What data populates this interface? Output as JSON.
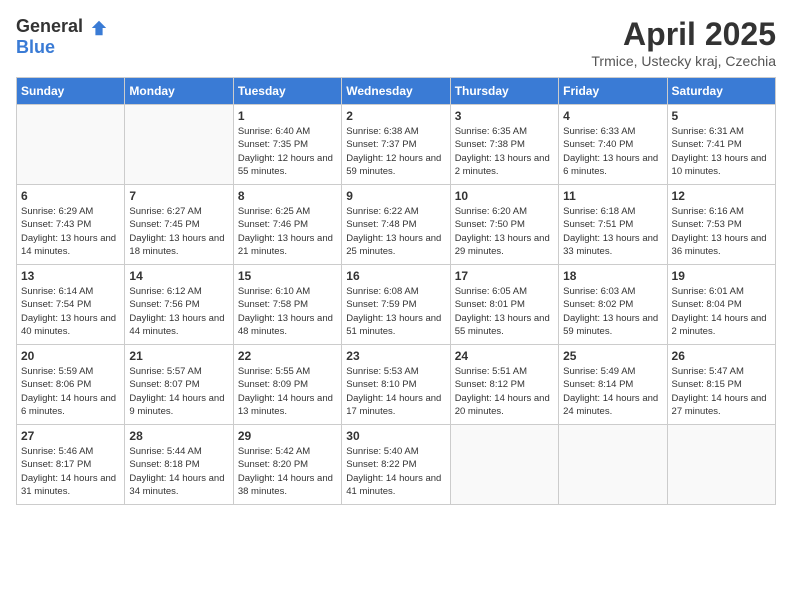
{
  "header": {
    "logo_general": "General",
    "logo_blue": "Blue",
    "title": "April 2025",
    "location": "Trmice, Ustecky kraj, Czechia"
  },
  "days_of_week": [
    "Sunday",
    "Monday",
    "Tuesday",
    "Wednesday",
    "Thursday",
    "Friday",
    "Saturday"
  ],
  "weeks": [
    [
      {
        "day": "",
        "sunrise": "",
        "sunset": "",
        "daylight": "",
        "empty": true
      },
      {
        "day": "",
        "sunrise": "",
        "sunset": "",
        "daylight": "",
        "empty": true
      },
      {
        "day": "1",
        "sunrise": "Sunrise: 6:40 AM",
        "sunset": "Sunset: 7:35 PM",
        "daylight": "Daylight: 12 hours and 55 minutes."
      },
      {
        "day": "2",
        "sunrise": "Sunrise: 6:38 AM",
        "sunset": "Sunset: 7:37 PM",
        "daylight": "Daylight: 12 hours and 59 minutes."
      },
      {
        "day": "3",
        "sunrise": "Sunrise: 6:35 AM",
        "sunset": "Sunset: 7:38 PM",
        "daylight": "Daylight: 13 hours and 2 minutes."
      },
      {
        "day": "4",
        "sunrise": "Sunrise: 6:33 AM",
        "sunset": "Sunset: 7:40 PM",
        "daylight": "Daylight: 13 hours and 6 minutes."
      },
      {
        "day": "5",
        "sunrise": "Sunrise: 6:31 AM",
        "sunset": "Sunset: 7:41 PM",
        "daylight": "Daylight: 13 hours and 10 minutes."
      }
    ],
    [
      {
        "day": "6",
        "sunrise": "Sunrise: 6:29 AM",
        "sunset": "Sunset: 7:43 PM",
        "daylight": "Daylight: 13 hours and 14 minutes."
      },
      {
        "day": "7",
        "sunrise": "Sunrise: 6:27 AM",
        "sunset": "Sunset: 7:45 PM",
        "daylight": "Daylight: 13 hours and 18 minutes."
      },
      {
        "day": "8",
        "sunrise": "Sunrise: 6:25 AM",
        "sunset": "Sunset: 7:46 PM",
        "daylight": "Daylight: 13 hours and 21 minutes."
      },
      {
        "day": "9",
        "sunrise": "Sunrise: 6:22 AM",
        "sunset": "Sunset: 7:48 PM",
        "daylight": "Daylight: 13 hours and 25 minutes."
      },
      {
        "day": "10",
        "sunrise": "Sunrise: 6:20 AM",
        "sunset": "Sunset: 7:50 PM",
        "daylight": "Daylight: 13 hours and 29 minutes."
      },
      {
        "day": "11",
        "sunrise": "Sunrise: 6:18 AM",
        "sunset": "Sunset: 7:51 PM",
        "daylight": "Daylight: 13 hours and 33 minutes."
      },
      {
        "day": "12",
        "sunrise": "Sunrise: 6:16 AM",
        "sunset": "Sunset: 7:53 PM",
        "daylight": "Daylight: 13 hours and 36 minutes."
      }
    ],
    [
      {
        "day": "13",
        "sunrise": "Sunrise: 6:14 AM",
        "sunset": "Sunset: 7:54 PM",
        "daylight": "Daylight: 13 hours and 40 minutes."
      },
      {
        "day": "14",
        "sunrise": "Sunrise: 6:12 AM",
        "sunset": "Sunset: 7:56 PM",
        "daylight": "Daylight: 13 hours and 44 minutes."
      },
      {
        "day": "15",
        "sunrise": "Sunrise: 6:10 AM",
        "sunset": "Sunset: 7:58 PM",
        "daylight": "Daylight: 13 hours and 48 minutes."
      },
      {
        "day": "16",
        "sunrise": "Sunrise: 6:08 AM",
        "sunset": "Sunset: 7:59 PM",
        "daylight": "Daylight: 13 hours and 51 minutes."
      },
      {
        "day": "17",
        "sunrise": "Sunrise: 6:05 AM",
        "sunset": "Sunset: 8:01 PM",
        "daylight": "Daylight: 13 hours and 55 minutes."
      },
      {
        "day": "18",
        "sunrise": "Sunrise: 6:03 AM",
        "sunset": "Sunset: 8:02 PM",
        "daylight": "Daylight: 13 hours and 59 minutes."
      },
      {
        "day": "19",
        "sunrise": "Sunrise: 6:01 AM",
        "sunset": "Sunset: 8:04 PM",
        "daylight": "Daylight: 14 hours and 2 minutes."
      }
    ],
    [
      {
        "day": "20",
        "sunrise": "Sunrise: 5:59 AM",
        "sunset": "Sunset: 8:06 PM",
        "daylight": "Daylight: 14 hours and 6 minutes."
      },
      {
        "day": "21",
        "sunrise": "Sunrise: 5:57 AM",
        "sunset": "Sunset: 8:07 PM",
        "daylight": "Daylight: 14 hours and 9 minutes."
      },
      {
        "day": "22",
        "sunrise": "Sunrise: 5:55 AM",
        "sunset": "Sunset: 8:09 PM",
        "daylight": "Daylight: 14 hours and 13 minutes."
      },
      {
        "day": "23",
        "sunrise": "Sunrise: 5:53 AM",
        "sunset": "Sunset: 8:10 PM",
        "daylight": "Daylight: 14 hours and 17 minutes."
      },
      {
        "day": "24",
        "sunrise": "Sunrise: 5:51 AM",
        "sunset": "Sunset: 8:12 PM",
        "daylight": "Daylight: 14 hours and 20 minutes."
      },
      {
        "day": "25",
        "sunrise": "Sunrise: 5:49 AM",
        "sunset": "Sunset: 8:14 PM",
        "daylight": "Daylight: 14 hours and 24 minutes."
      },
      {
        "day": "26",
        "sunrise": "Sunrise: 5:47 AM",
        "sunset": "Sunset: 8:15 PM",
        "daylight": "Daylight: 14 hours and 27 minutes."
      }
    ],
    [
      {
        "day": "27",
        "sunrise": "Sunrise: 5:46 AM",
        "sunset": "Sunset: 8:17 PM",
        "daylight": "Daylight: 14 hours and 31 minutes."
      },
      {
        "day": "28",
        "sunrise": "Sunrise: 5:44 AM",
        "sunset": "Sunset: 8:18 PM",
        "daylight": "Daylight: 14 hours and 34 minutes."
      },
      {
        "day": "29",
        "sunrise": "Sunrise: 5:42 AM",
        "sunset": "Sunset: 8:20 PM",
        "daylight": "Daylight: 14 hours and 38 minutes."
      },
      {
        "day": "30",
        "sunrise": "Sunrise: 5:40 AM",
        "sunset": "Sunset: 8:22 PM",
        "daylight": "Daylight: 14 hours and 41 minutes."
      },
      {
        "day": "",
        "sunrise": "",
        "sunset": "",
        "daylight": "",
        "empty": true
      },
      {
        "day": "",
        "sunrise": "",
        "sunset": "",
        "daylight": "",
        "empty": true
      },
      {
        "day": "",
        "sunrise": "",
        "sunset": "",
        "daylight": "",
        "empty": true
      }
    ]
  ]
}
